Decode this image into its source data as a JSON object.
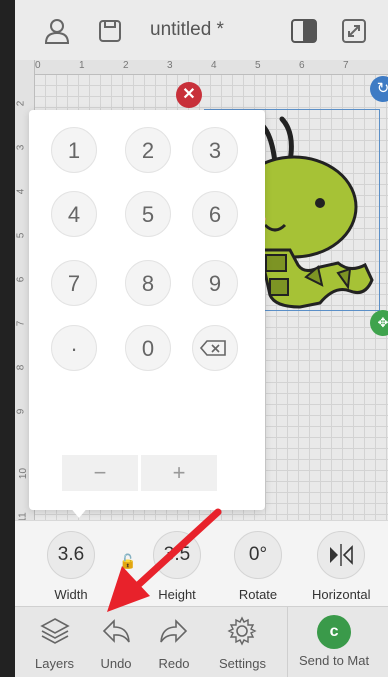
{
  "topbar": {
    "title": "untitled *",
    "icons": [
      "profile-icon",
      "save-icon",
      "split-view-icon",
      "fullscreen-icon"
    ]
  },
  "ruler": {
    "top_marks": [
      "0",
      "1",
      "2",
      "3",
      "4",
      "5",
      "6",
      "7"
    ],
    "left_marks": [
      "2",
      "3",
      "4",
      "5",
      "6",
      "7",
      "8",
      "9",
      "10",
      "11"
    ]
  },
  "keypad": {
    "keys": [
      "1",
      "2",
      "3",
      "4",
      "5",
      "6",
      "7",
      "8",
      "9",
      "·",
      "0"
    ],
    "minus": "−",
    "plus": "+"
  },
  "properties": {
    "width": {
      "value": "3.6",
      "label": "Width"
    },
    "height": {
      "value": "3.5",
      "label": "Height"
    },
    "rotate": {
      "value": "0°",
      "label": "Rotate"
    },
    "flip": {
      "label": "Horizontal"
    }
  },
  "toolbar": {
    "layers": "Layers",
    "undo": "Undo",
    "redo": "Redo",
    "settings": "Settings",
    "send": "Send to Mat"
  },
  "colors": {
    "delete": "#c8303a",
    "rotate": "#3e7bc4",
    "move": "#3fa34d",
    "send": "#3a9a4a",
    "annotation_arrow": "#e8222b",
    "worm_body": "#a6c236"
  }
}
